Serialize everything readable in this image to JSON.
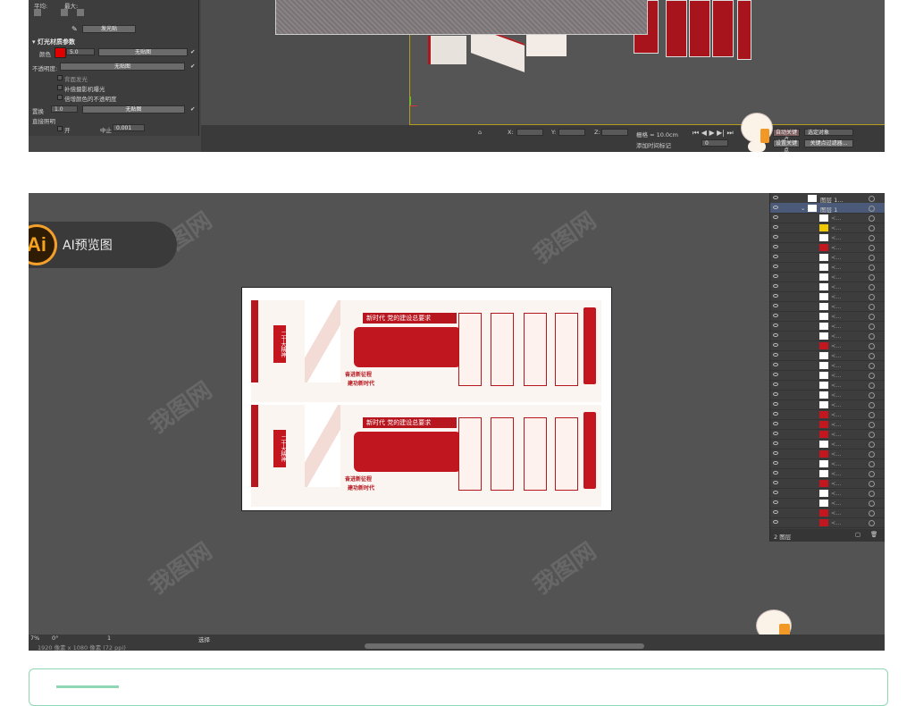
{
  "max": {
    "top_labels": [
      "平均:",
      "最大:"
    ],
    "section_title": "灯光材质参数",
    "color_label": "颜色",
    "color_value": "5.0",
    "nomap": "无贴图",
    "opacity_label": "不透明度:",
    "backface_label": "背面发光",
    "shadow_label": "补偿摄影机曝光",
    "multiply_label": "倍增颜色的不透明度",
    "displace_label": "置换",
    "displace_value": "1.0",
    "direct_label": "直接照明",
    "on_label": "开",
    "stop_label": "中止",
    "stop_value": "0.001",
    "grid_label": "栅格 = 10.0cm",
    "autokey": "自动关键点",
    "set_key": "设置关键点",
    "selected": "选定对象",
    "key_filter": "关键点过滤器...",
    "add_time_tag": "添加时间标记",
    "frame": "0",
    "x_label": "X:",
    "y_label": "Y:",
    "z_label": "Z:",
    "glow_label": "发光贴"
  },
  "ai": {
    "logo_text": "Ai",
    "preview_label": "AI预览图",
    "board": {
      "headline": "新时代",
      "subtitle": "党的建设总要求",
      "vertical": "二十大精神",
      "slogan1": "奋进新征程",
      "slogan2": "建功新时代"
    },
    "layers": {
      "layer_2": "图层 1...",
      "layer_1": "图层 1",
      "footer": "2 图层",
      "item": "<..."
    },
    "status": {
      "zoom": "7%",
      "angle": "0°",
      "artboard_num": "1",
      "tool": "选择",
      "doc_size": "1920 像素 x 1080 像素 (72 ppi)"
    }
  },
  "watermark": "我图网"
}
